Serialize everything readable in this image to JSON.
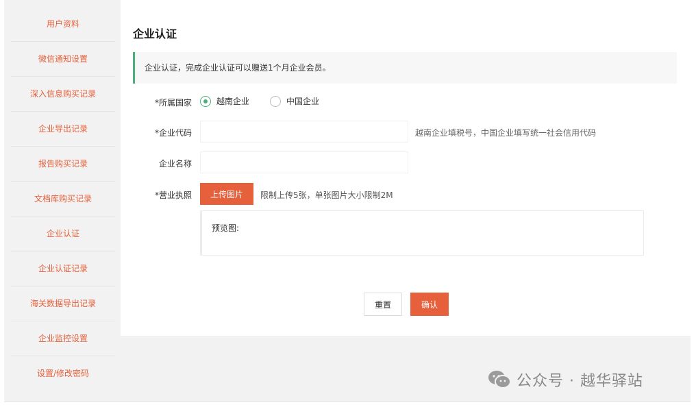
{
  "sidebar": {
    "items": [
      {
        "label": "用户资料"
      },
      {
        "label": "微信通知设置"
      },
      {
        "label": "深入信息购买记录"
      },
      {
        "label": "企业导出记录"
      },
      {
        "label": "报告购买记录"
      },
      {
        "label": "文档库购买记录"
      },
      {
        "label": "企业认证"
      },
      {
        "label": "企业认证记录"
      },
      {
        "label": "海关数据导出记录"
      },
      {
        "label": "企业监控设置"
      },
      {
        "label": "设置/修改密码"
      }
    ]
  },
  "main": {
    "title": "企业认证",
    "notice": "企业认证，完成企业认证可以赠送1个月企业会员。"
  },
  "form": {
    "country": {
      "label": "*所属国家",
      "options": [
        {
          "label": "越南企业",
          "checked": true
        },
        {
          "label": "中国企业",
          "checked": false
        }
      ]
    },
    "company_code": {
      "label": "*企业代码",
      "value": "",
      "placeholder": "",
      "hint": "越南企业填税号，中国企业填写统一社会信用代码"
    },
    "company_name": {
      "label": "企业名称",
      "value": "",
      "placeholder": ""
    },
    "license": {
      "label": "*营业执照",
      "upload_label": "上传图片",
      "hint": "限制上传5张，单张图片大小限制2M",
      "preview_label": "预览图:"
    },
    "reset_label": "重置",
    "confirm_label": "确认"
  },
  "watermark": {
    "icon": "wechat-icon",
    "text": "公众号 · 越华驿站"
  },
  "colors": {
    "accent": "#e5603b",
    "success": "#4caf79"
  }
}
